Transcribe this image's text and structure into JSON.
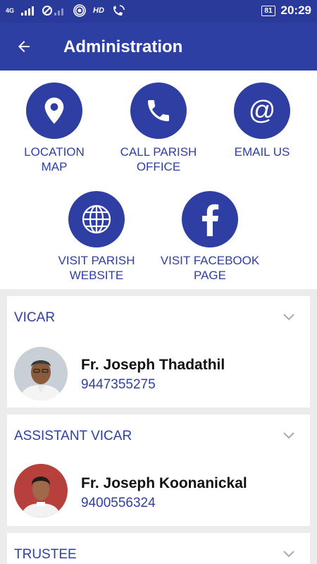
{
  "status_bar": {
    "network": "4G",
    "hd": "HD",
    "battery": "81",
    "time": "20:29"
  },
  "appbar": {
    "title": "Administration"
  },
  "actions": [
    {
      "line1": "LOCATION",
      "line2": "MAP",
      "icon": "location-pin-icon"
    },
    {
      "line1": "CALL PARISH",
      "line2": "OFFICE",
      "icon": "phone-icon"
    },
    {
      "line1": "EMAIL US",
      "line2": "",
      "icon": "at-sign-icon"
    },
    {
      "line1": "VISIT PARISH",
      "line2": "WEBSITE",
      "icon": "globe-icon"
    },
    {
      "line1": "VISIT FACEBOOK",
      "line2": "PAGE",
      "icon": "facebook-icon"
    }
  ],
  "sections": [
    {
      "title": "VICAR",
      "name": "Fr. Joseph Thadathil",
      "phone": "9447355275"
    },
    {
      "title": "ASSISTANT VICAR",
      "name": "Fr. Joseph Koonanickal",
      "phone": "9400556324"
    },
    {
      "title": "TRUSTEE"
    }
  ],
  "colors": {
    "primary": "#2e3fa3",
    "status_bar": "#2a3a9a",
    "background": "#ececec"
  }
}
